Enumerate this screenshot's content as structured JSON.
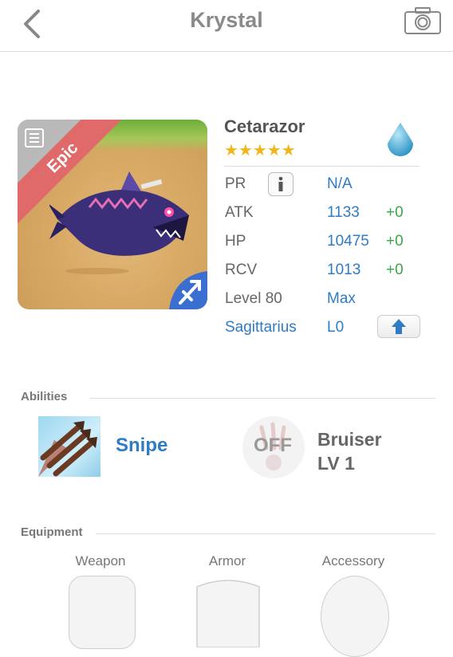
{
  "header": {
    "title": "Krystal",
    "back_icon": "chevron-left-icon",
    "camera_icon": "camera-icon"
  },
  "monster": {
    "name": "Cetarazor",
    "rarity": "Epic",
    "stars": "★★★★★",
    "star_count": 5,
    "element_icon": "water-drop-icon",
    "stats": {
      "pr_label": "PR",
      "pr_value": "N/A",
      "atk_label": "ATK",
      "atk_value": "1133",
      "atk_bonus": "+0",
      "hp_label": "HP",
      "hp_value": "10475",
      "hp_bonus": "+0",
      "rcv_label": "RCV",
      "rcv_value": "1013",
      "rcv_bonus": "+0",
      "level_label": "Level 80",
      "level_value": "Max",
      "sign_label": "Sagittarius",
      "sign_value": "L0"
    }
  },
  "abilities": {
    "title": "Abilities",
    "active": {
      "name": "Snipe",
      "icon": "arrows-icon"
    },
    "passive": {
      "state": "OFF",
      "name": "Bruiser",
      "level": "LV 1",
      "icon": "claw-icon"
    }
  },
  "equipment": {
    "title": "Equipment",
    "slots": [
      "Weapon",
      "Armor",
      "Accessory"
    ]
  },
  "colors": {
    "accent": "#2f7bc4",
    "bonus": "#3aa845",
    "rarity": "#e06a6a",
    "stars": "#f2b61b"
  }
}
